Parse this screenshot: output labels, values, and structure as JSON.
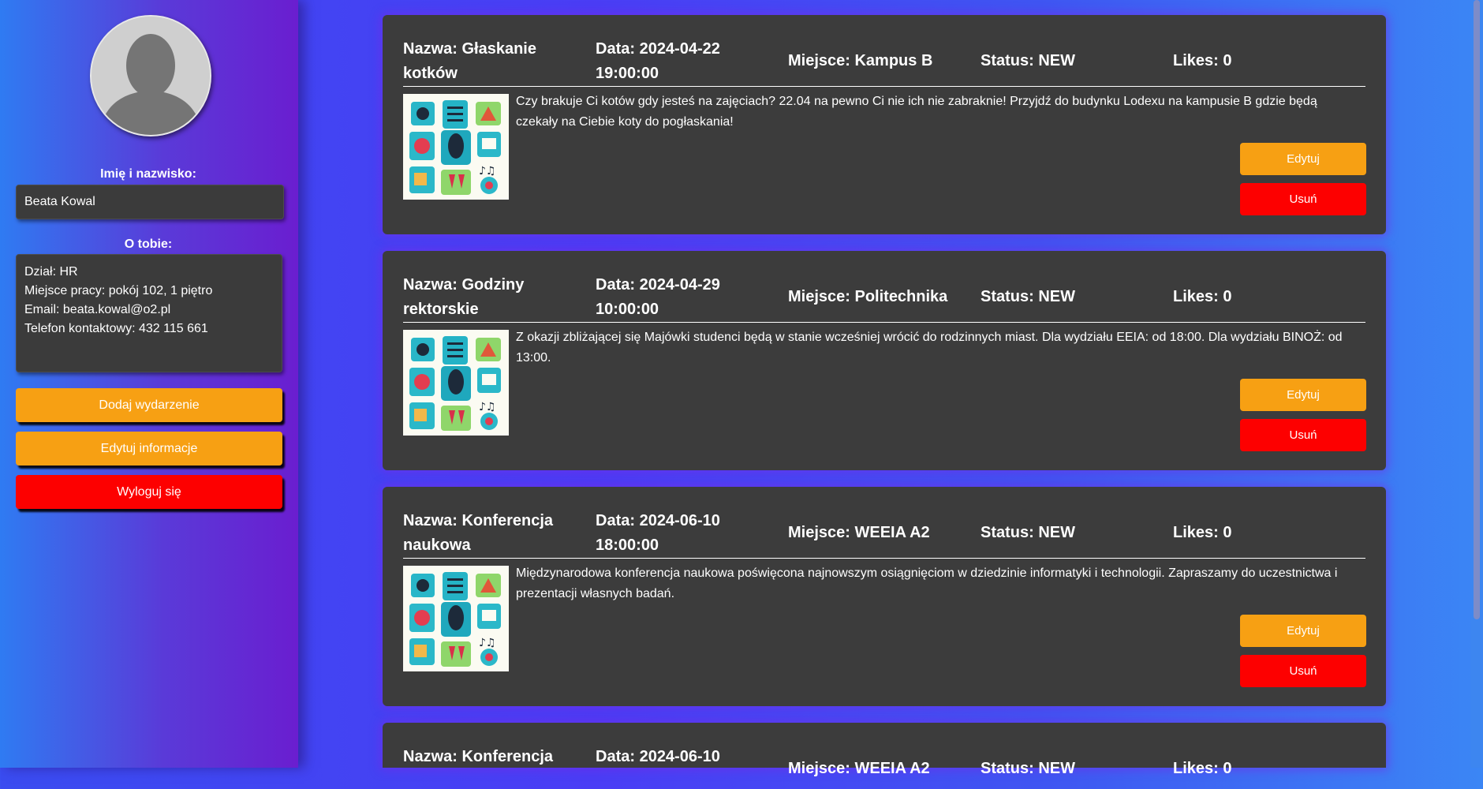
{
  "profile": {
    "name_label": "Imię i nazwisko:",
    "name_value": "Beata Kowal",
    "about_label": "O tobie:",
    "about_value": "Dział: HR\nMiejsce pracy: pokój 102, 1 piętro\nEmail: beata.kowal@o2.pl\nTelefon kontaktowy: 432 115 661"
  },
  "sidebar_buttons": {
    "add_event": "Dodaj wydarzenie",
    "edit_info": "Edytuj informacje",
    "logout": "Wyloguj się"
  },
  "events": [
    {
      "name": "Nazwa: Głaskanie kotków",
      "date": "Data: 2024-04-22 19:00:00",
      "place": "Miejsce: Kampus B",
      "status": "Status: NEW",
      "likes": "Likes: 0",
      "description": "Czy brakuje Ci kotów gdy jesteś na zajęciach? 22.04 na pewno Ci nie ich nie zabraknie! Przyjdź do budynku Lodexu na kampusie B gdzie będą czekały na Ciebie koty do pogłaskania!",
      "edit_label": "Edytuj",
      "delete_label": "Usuń"
    },
    {
      "name": "Nazwa: Godziny rektorskie",
      "date": "Data: 2024-04-29 10:00:00",
      "place": "Miejsce: Politechnika",
      "status": "Status: NEW",
      "likes": "Likes: 0",
      "description": "Z okazji zbliżającej się Majówki studenci będą w stanie wcześniej wrócić do rodzinnych miast. Dla wydziału EEIA: od 18:00. Dla wydziału BINOŻ: od 13:00.",
      "edit_label": "Edytuj",
      "delete_label": "Usuń"
    },
    {
      "name": "Nazwa: Konferencja naukowa",
      "date": "Data: 2024-06-10 18:00:00",
      "place": "Miejsce: WEEIA A2",
      "status": "Status: NEW",
      "likes": "Likes: 0",
      "description": "Międzynarodowa konferencja naukowa poświęcona najnowszym osiągnięciom w dziedzinie informatyki i technologii. Zapraszamy do uczestnictwa i prezentacji własnych badań.",
      "edit_label": "Edytuj",
      "delete_label": "Usuń"
    },
    {
      "name": "Nazwa: Konferencja",
      "date": "Data: 2024-06-10",
      "place": "Miejsce: WEEIA A2",
      "status": "Status: NEW",
      "likes": "Likes: 0"
    }
  ],
  "colors": {
    "orange": "#f7a013",
    "red": "#fd0000",
    "card": "#3c3c3c"
  }
}
